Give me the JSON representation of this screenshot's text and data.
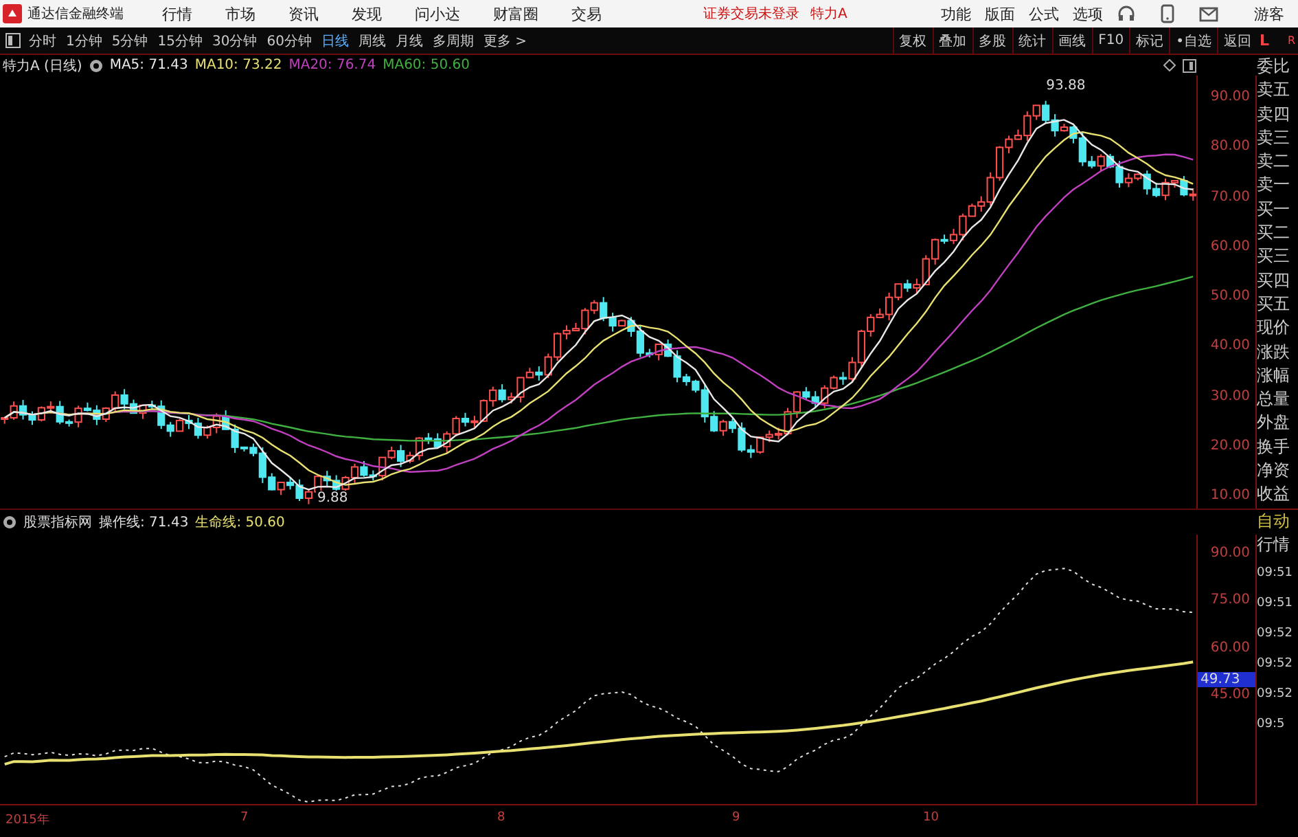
{
  "menubar": {
    "app_title": "通达信金融终端",
    "menus": [
      "行情",
      "市场",
      "资讯",
      "发现",
      "问小达",
      "财富圈",
      "交易"
    ],
    "notice": "证券交易未登录",
    "stock": "特力A",
    "right_menus": [
      "功能",
      "版面",
      "公式",
      "选项"
    ],
    "user": "游客"
  },
  "toolbar": {
    "periods": [
      {
        "label": "分时",
        "selected": false
      },
      {
        "label": "1分钟",
        "selected": false
      },
      {
        "label": "5分钟",
        "selected": false
      },
      {
        "label": "15分钟",
        "selected": false
      },
      {
        "label": "30分钟",
        "selected": false
      },
      {
        "label": "60分钟",
        "selected": false
      },
      {
        "label": "日线",
        "selected": true
      },
      {
        "label": "周线",
        "selected": false
      },
      {
        "label": "月线",
        "selected": false
      },
      {
        "label": "多周期",
        "selected": false
      },
      {
        "label": "更多 >",
        "selected": false
      }
    ],
    "tools": [
      "复权",
      "叠加",
      "多股",
      "统计",
      "画线",
      "F10",
      "标记",
      "•自选",
      "返回"
    ],
    "corner": [
      "L",
      "R"
    ]
  },
  "main_legend": {
    "title": "特力A (日线)",
    "ma": [
      {
        "label": "MA5: 71.43",
        "color": "#e8e8e8"
      },
      {
        "label": "MA10: 73.22",
        "color": "#e8e070"
      },
      {
        "label": "MA20: 76.74",
        "color": "#c040c0"
      },
      {
        "label": "MA60: 50.60",
        "color": "#40b040"
      }
    ]
  },
  "price_axis": [
    "90.00",
    "80.00",
    "70.00",
    "60.00",
    "50.00",
    "40.00",
    "30.00",
    "20.00",
    "10.00"
  ],
  "annotations": {
    "high": "93.88",
    "low": "9.88"
  },
  "indicator_legend": {
    "name": "股票指标网",
    "lines": [
      {
        "label": "操作线: 71.43",
        "color": "#e0e0e0"
      },
      {
        "label": "生命线: 50.60",
        "color": "#e8e070"
      }
    ]
  },
  "indicator_axis": [
    "90.00",
    "75.00",
    "60.00",
    "45.00"
  ],
  "indicator_marker": "49.73",
  "x_axis": [
    "2015年",
    "7",
    "8",
    "9",
    "10"
  ],
  "side_panel": {
    "quote_labels": [
      "委比",
      "卖五",
      "卖四",
      "卖三",
      "卖二",
      "卖一",
      "买一",
      "买二",
      "买三",
      "买四",
      "买五",
      "现价",
      "涨跌",
      "涨幅",
      "总量",
      "外盘",
      "换手",
      "净资",
      "收益"
    ],
    "trade_labels": [
      "自动",
      "行情"
    ],
    "times": [
      "09:51",
      "09:51",
      "09:52",
      "09:52",
      "09:52",
      "09:5"
    ]
  }
}
